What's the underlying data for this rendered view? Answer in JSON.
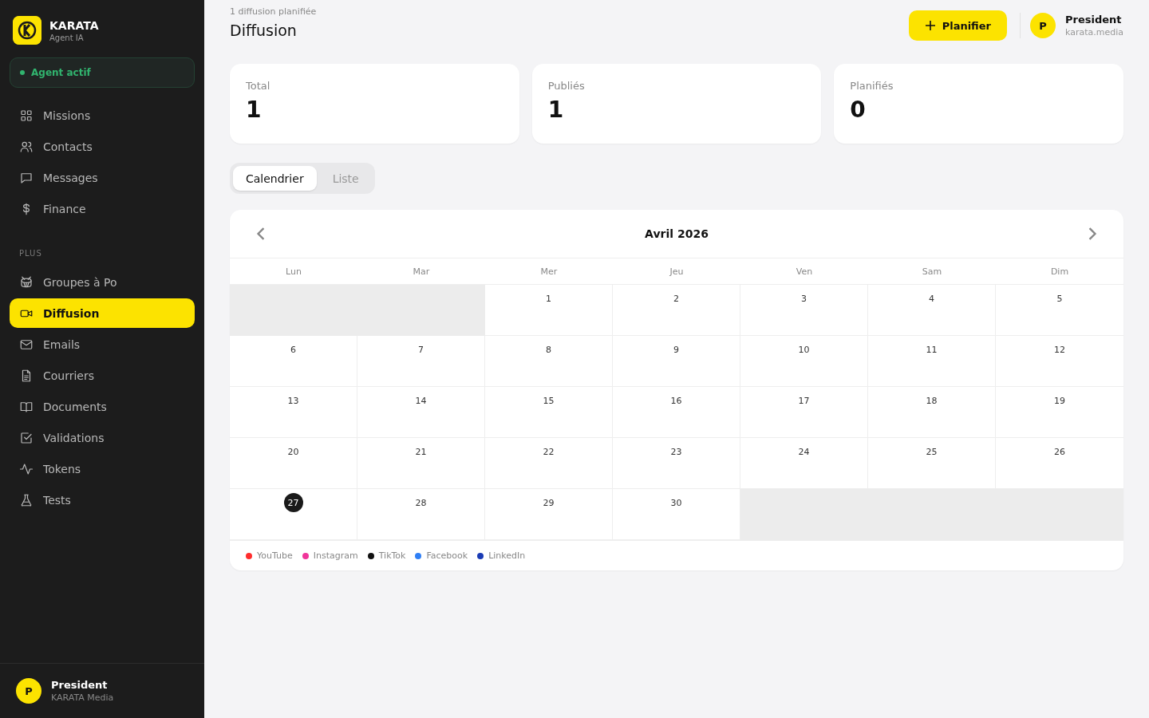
{
  "brand": {
    "name": "KARATA",
    "subtitle": "Agent IA"
  },
  "agent_status": {
    "label": "Agent actif",
    "on": true
  },
  "nav_main": [
    {
      "label": "Missions",
      "selected": false
    },
    {
      "label": "Contacts",
      "selected": false
    },
    {
      "label": "Messages",
      "selected": false
    },
    {
      "label": "Finance",
      "selected": false
    }
  ],
  "nav_section": "PLUS",
  "nav_plus": [
    {
      "label": "Groupes à Po",
      "selected": false
    },
    {
      "label": "Diffusion",
      "selected": true
    },
    {
      "label": "Emails",
      "selected": false
    },
    {
      "label": "Courriers",
      "selected": false
    },
    {
      "label": "Documents",
      "selected": false
    },
    {
      "label": "Validations",
      "selected": false
    },
    {
      "label": "Tokens",
      "selected": false
    },
    {
      "label": "Tests",
      "selected": false
    }
  ],
  "sidebar_user": {
    "initial": "P",
    "name": "President",
    "org": "KARATA Media"
  },
  "header": {
    "subtitle": "1 diffusion planifiée",
    "title": "Diffusion",
    "action": "Planifier",
    "user": {
      "initial": "P",
      "name": "President",
      "domain": "karata.media"
    }
  },
  "stats": [
    {
      "label": "Total",
      "value": "1"
    },
    {
      "label": "Publiés",
      "value": "1"
    },
    {
      "label": "Planifiés",
      "value": "0"
    }
  ],
  "view_tabs": [
    {
      "label": "Calendrier",
      "selected": true
    },
    {
      "label": "Liste",
      "selected": false
    }
  ],
  "calendar": {
    "month": "Avril 2026",
    "weekdays": [
      "Lun",
      "Mar",
      "Mer",
      "Jeu",
      "Ven",
      "Sam",
      "Dim"
    ],
    "cells": [
      {
        "kind": "blank"
      },
      {
        "kind": "blank"
      },
      {
        "kind": "day",
        "day": "1",
        "today": false
      },
      {
        "kind": "day",
        "day": "2",
        "today": false
      },
      {
        "kind": "day",
        "day": "3",
        "today": false
      },
      {
        "kind": "day",
        "day": "4",
        "today": false
      },
      {
        "kind": "day",
        "day": "5",
        "today": false
      },
      {
        "kind": "day",
        "day": "6",
        "today": false
      },
      {
        "kind": "day",
        "day": "7",
        "today": false
      },
      {
        "kind": "day",
        "day": "8",
        "today": false
      },
      {
        "kind": "day",
        "day": "9",
        "today": false
      },
      {
        "kind": "day",
        "day": "10",
        "today": false
      },
      {
        "kind": "day",
        "day": "11",
        "today": false
      },
      {
        "kind": "day",
        "day": "12",
        "today": false
      },
      {
        "kind": "day",
        "day": "13",
        "today": false
      },
      {
        "kind": "day",
        "day": "14",
        "today": false
      },
      {
        "kind": "day",
        "day": "15",
        "today": false
      },
      {
        "kind": "day",
        "day": "16",
        "today": false
      },
      {
        "kind": "day",
        "day": "17",
        "today": false
      },
      {
        "kind": "day",
        "day": "18",
        "today": false
      },
      {
        "kind": "day",
        "day": "19",
        "today": false
      },
      {
        "kind": "day",
        "day": "20",
        "today": false
      },
      {
        "kind": "day",
        "day": "21",
        "today": false
      },
      {
        "kind": "day",
        "day": "22",
        "today": false
      },
      {
        "kind": "day",
        "day": "23",
        "today": false
      },
      {
        "kind": "day",
        "day": "24",
        "today": false
      },
      {
        "kind": "day",
        "day": "25",
        "today": false
      },
      {
        "kind": "day",
        "day": "26",
        "today": false
      },
      {
        "kind": "day",
        "day": "27",
        "today": true
      },
      {
        "kind": "day",
        "day": "28",
        "today": false
      },
      {
        "kind": "day",
        "day": "29",
        "today": false
      },
      {
        "kind": "day",
        "day": "30",
        "today": false
      },
      {
        "kind": "blank"
      },
      {
        "kind": "blank"
      },
      {
        "kind": "blank"
      }
    ],
    "legend": [
      {
        "label": "YouTube",
        "color": "#ff2d2d"
      },
      {
        "label": "Instagram",
        "color": "#f0359a"
      },
      {
        "label": "TikTok",
        "color": "#111111"
      },
      {
        "label": "Facebook",
        "color": "#2f7ff5"
      },
      {
        "label": "LinkedIn",
        "color": "#1a3bb5"
      }
    ]
  }
}
